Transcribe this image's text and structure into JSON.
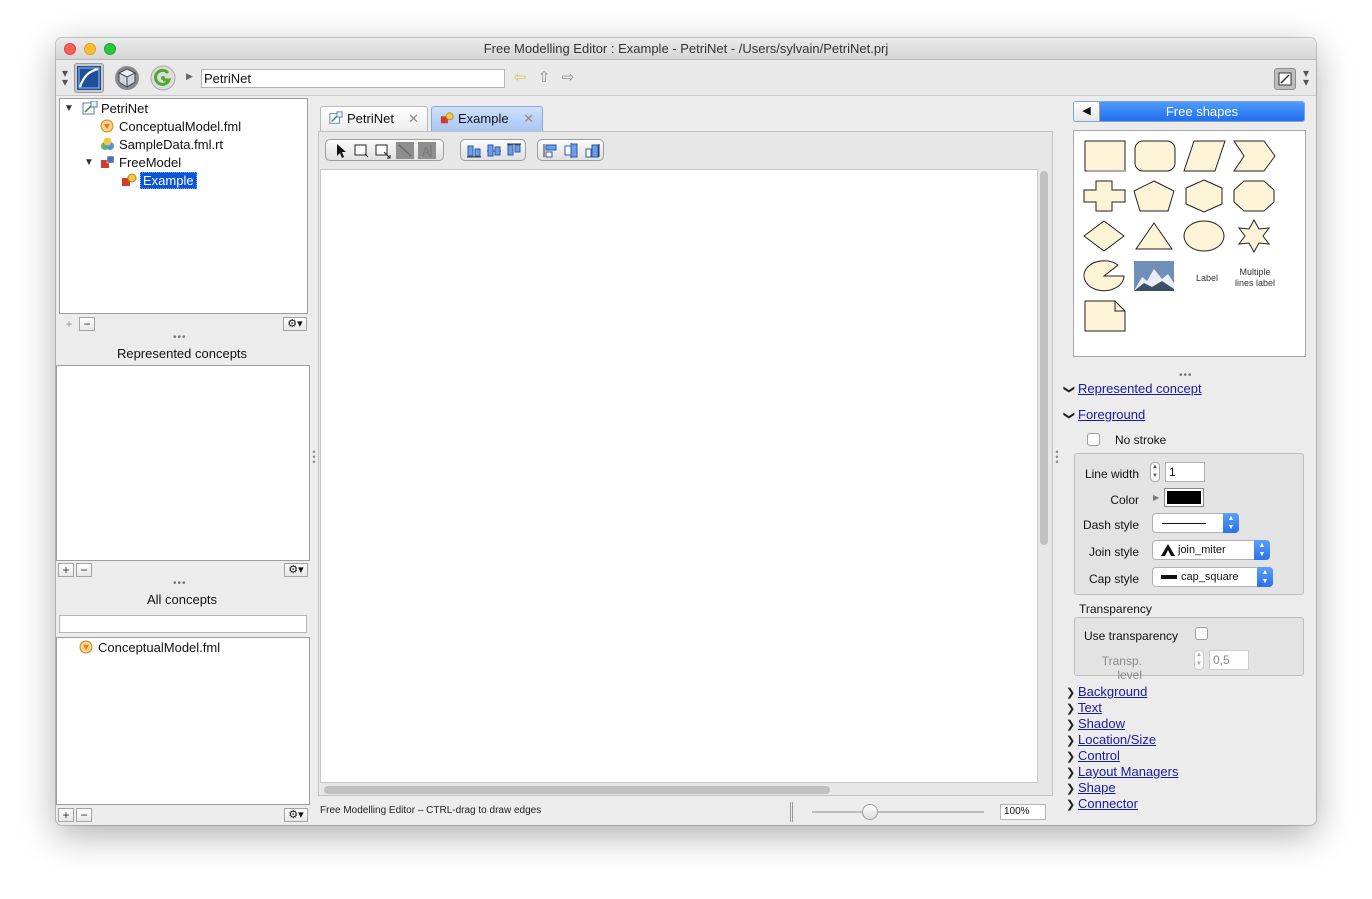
{
  "window": {
    "title": "Free Modelling Editor : Example - PetriNet - /Users/sylvain/PetriNet.prj"
  },
  "toolbar": {
    "path_value": "PetriNet",
    "icons": [
      "modelling-editor-icon",
      "cube-icon",
      "green-g-icon",
      "back-arrow-icon",
      "up-arrow-icon",
      "forward-arrow-icon",
      "layout-toggle-icon"
    ]
  },
  "project_tree": {
    "items": [
      {
        "label": "PetriNet",
        "level": 0,
        "expanded": true
      },
      {
        "label": "ConceptualModel.fml",
        "level": 1
      },
      {
        "label": "SampleData.fml.rt",
        "level": 1
      },
      {
        "label": "FreeModel",
        "level": 1,
        "expanded": true
      },
      {
        "label": "Example",
        "level": 2,
        "selected": true
      }
    ]
  },
  "represented_concepts": {
    "title": "Represented concepts"
  },
  "all_concepts": {
    "title": "All concepts",
    "search_value": "",
    "items": [
      {
        "label": "ConceptualModel.fml"
      }
    ]
  },
  "editor": {
    "tabs": [
      {
        "label": "PetriNet",
        "active": false
      },
      {
        "label": "Example",
        "active": true
      }
    ],
    "status_text": "Free Modelling Editor – CTRL-drag to draw edges",
    "zoom_value": "100%"
  },
  "palette": {
    "title": "Free shapes",
    "label_text": "Label",
    "multiline_text": "Multiple lines label"
  },
  "inspector": {
    "represented_concept": "Represented concept",
    "foreground": "Foreground",
    "no_stroke": "No stroke",
    "line_width_label": "Line width",
    "line_width_value": "1",
    "color_label": "Color",
    "dash_style_label": "Dash style",
    "join_style_label": "Join style",
    "join_style_value": "join_miter",
    "cap_style_label": "Cap style",
    "cap_style_value": "cap_square",
    "transparency_title": "Transparency",
    "use_transparency_label": "Use transparency",
    "transp_level_label": "Transp. level",
    "transp_level_value": "0,5",
    "sections": [
      "Background",
      "Text",
      "Shadow",
      "Location/Size",
      "Control",
      "Layout Managers",
      "Shape",
      "Connector"
    ],
    "colors": {
      "stroke_color": "#000000",
      "shape_fill": "#fdf3d7",
      "accent": "#2a72e8"
    }
  }
}
